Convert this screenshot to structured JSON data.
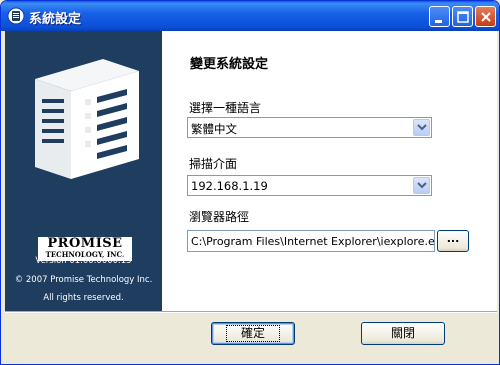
{
  "window": {
    "title": "系統設定"
  },
  "sidebar": {
    "logo_main": "PROMISE",
    "logo_sub": "TECHNOLOGY, INC.",
    "version": "Version 01.00.0000.15",
    "copyright": "© 2007 Promise Technology Inc.",
    "rights": "All rights reserved."
  },
  "main": {
    "heading": "變更系統設定",
    "language": {
      "label": "選擇一種語言",
      "value": "繁體中文"
    },
    "scan": {
      "label": "掃描介面",
      "value": "192.168.1.19"
    },
    "browser_path": {
      "label": "瀏覽器路徑",
      "value": "C:\\Program Files\\Internet Explorer\\iexplore.exe",
      "browse_label": "..."
    }
  },
  "footer": {
    "ok_label": "確定",
    "close_label": "關閉"
  },
  "colors": {
    "titlebar": "#1861e8",
    "sidebar_bg": "#1e3d5f",
    "dialog_bg": "#ece9d8"
  }
}
